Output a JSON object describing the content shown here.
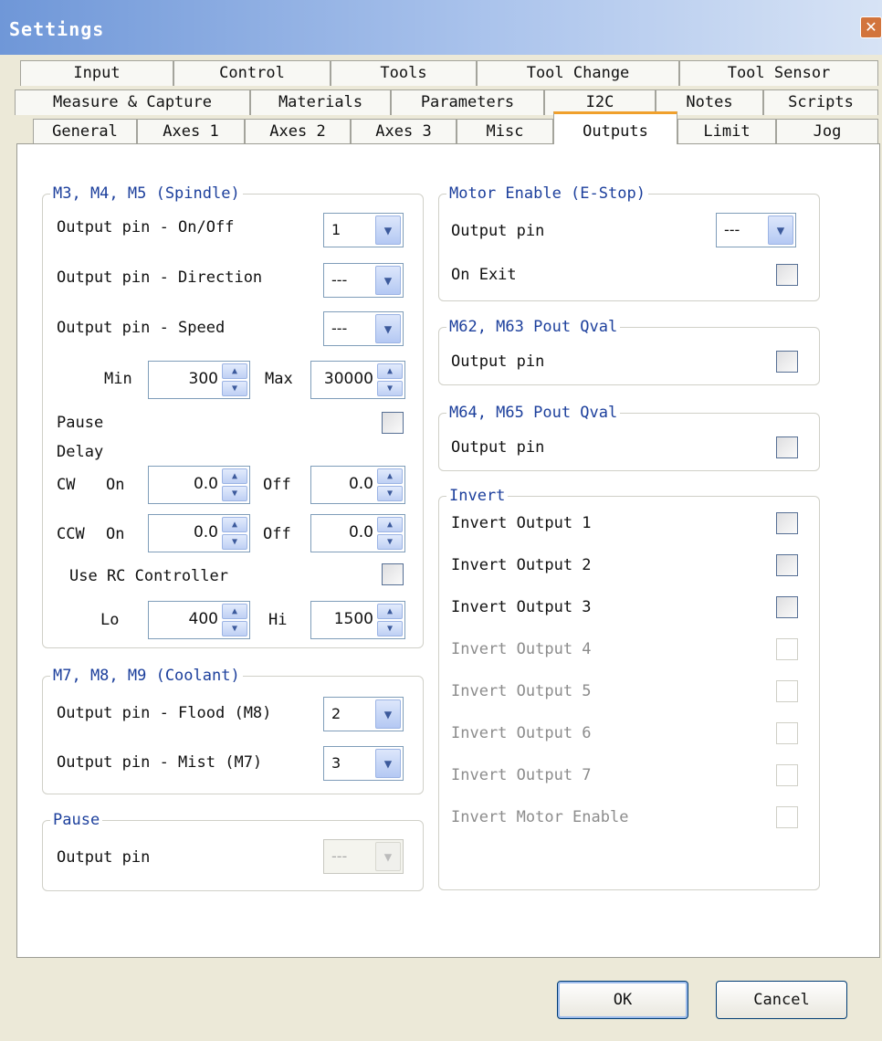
{
  "window": {
    "title": "Settings"
  },
  "tabs": {
    "row1": [
      "Input",
      "Control",
      "Tools",
      "Tool Change",
      "Tool Sensor"
    ],
    "row2": [
      "Measure & Capture",
      "Materials",
      "Parameters",
      "I2C",
      "Notes",
      "Scripts"
    ],
    "row3": [
      "General",
      "Axes 1",
      "Axes 2",
      "Axes 3",
      "Misc",
      "Outputs",
      "Limit",
      "Jog"
    ],
    "active": "Outputs"
  },
  "spindle": {
    "legend": "M3, M4, M5 (Spindle)",
    "onoff_label": "Output pin - On/Off",
    "onoff_value": "1",
    "direction_label": "Output pin - Direction",
    "direction_value": "---",
    "speed_label": "Output pin - Speed",
    "speed_value": "---",
    "min_label": "Min",
    "min_value": "300",
    "max_label": "Max",
    "max_value": "30000",
    "pause_label": "Pause",
    "delay_label": "Delay",
    "cw_label": "CW",
    "cw_on_label": "On",
    "cw_on_value": "0.0",
    "cw_off_label": "Off",
    "cw_off_value": "0.0",
    "ccw_label": "CCW",
    "ccw_on_label": "On",
    "ccw_on_value": "0.0",
    "ccw_off_label": "Off",
    "ccw_off_value": "0.0",
    "rc_label": "Use RC Controller",
    "lo_label": "Lo",
    "lo_value": "400",
    "hi_label": "Hi",
    "hi_value": "1500"
  },
  "coolant": {
    "legend": "M7, M8, M9 (Coolant)",
    "flood_label": "Output pin - Flood (M8)",
    "flood_value": "2",
    "mist_label": "Output pin - Mist (M7)",
    "mist_value": "3"
  },
  "pause_group": {
    "legend": "Pause",
    "output_label": "Output pin",
    "output_value": "---"
  },
  "motor_enable": {
    "legend": "Motor Enable (E-Stop)",
    "output_label": "Output pin",
    "output_value": "---",
    "on_exit_label": "On Exit"
  },
  "m62": {
    "legend": "M62, M63 Pout Qval",
    "output_label": "Output pin"
  },
  "m64": {
    "legend": "M64, M65 Pout Qval",
    "output_label": "Output pin"
  },
  "invert": {
    "legend": "Invert",
    "items": [
      {
        "label": "Invert Output 1",
        "enabled": true
      },
      {
        "label": "Invert Output 2",
        "enabled": true
      },
      {
        "label": "Invert Output 3",
        "enabled": true
      },
      {
        "label": "Invert Output 4",
        "enabled": false
      },
      {
        "label": "Invert Output 5",
        "enabled": false
      },
      {
        "label": "Invert Output 6",
        "enabled": false
      },
      {
        "label": "Invert Output 7",
        "enabled": false
      },
      {
        "label": "Invert Motor Enable",
        "enabled": false
      }
    ]
  },
  "buttons": {
    "ok": "OK",
    "cancel": "Cancel"
  },
  "colors": {
    "legend_text": "#1c3f9c",
    "active_tab_accent": "#f0a02c",
    "title_bar": "#6f97d8"
  }
}
